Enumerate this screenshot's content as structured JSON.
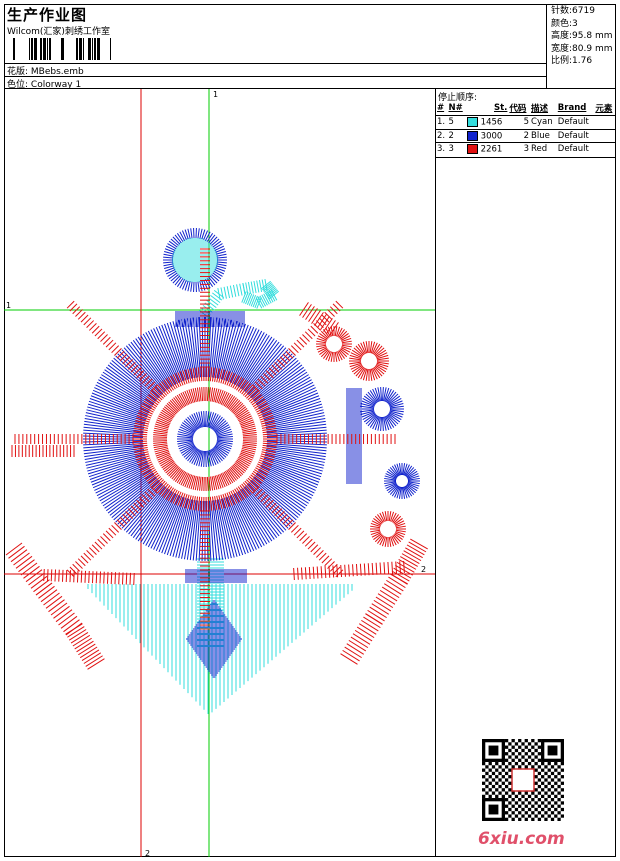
{
  "header": {
    "title": "生产作业图",
    "company": "Wilcom(汇家)刺绣工作室",
    "design_label": "花版:",
    "design_value": "MBebs.emb",
    "color_label": "色位:",
    "color_value": "Colorway 1"
  },
  "stats": [
    {
      "label": "针数:",
      "value": "6719"
    },
    {
      "label": "颜色:",
      "value": "3"
    },
    {
      "label": "高度:",
      "value": "95.8 mm"
    },
    {
      "label": "宽度:",
      "value": "80.9 mm"
    },
    {
      "label": "比例:",
      "value": "1.76"
    }
  ],
  "stop_sequence": {
    "title": "停止顺序:",
    "columns": [
      "#",
      "N#",
      "St.",
      "代码",
      "描述",
      "Brand",
      "元素"
    ],
    "rows": [
      {
        "idx": "1.",
        "n": "5",
        "st": "1456",
        "code": "5",
        "desc": "Cyan",
        "brand": "Default",
        "color": "#33dddd"
      },
      {
        "idx": "2.",
        "n": "2",
        "st": "3000",
        "code": "2",
        "desc": "Blue",
        "brand": "Default",
        "color": "#1022cc"
      },
      {
        "idx": "3.",
        "n": "3",
        "st": "2261",
        "code": "3",
        "desc": "Red",
        "brand": "Default",
        "color": "#e01010"
      }
    ]
  },
  "guides": {
    "v1_label": "1",
    "h1_label": "1",
    "h2_label": "2",
    "v2_label": "2"
  },
  "colors": {
    "cyan": "#33dddd",
    "blue": "#1022cc",
    "red": "#e01010",
    "guide_green": "#00cc00",
    "guide_red": "#dd0000"
  },
  "watermark": "6xiu.com"
}
